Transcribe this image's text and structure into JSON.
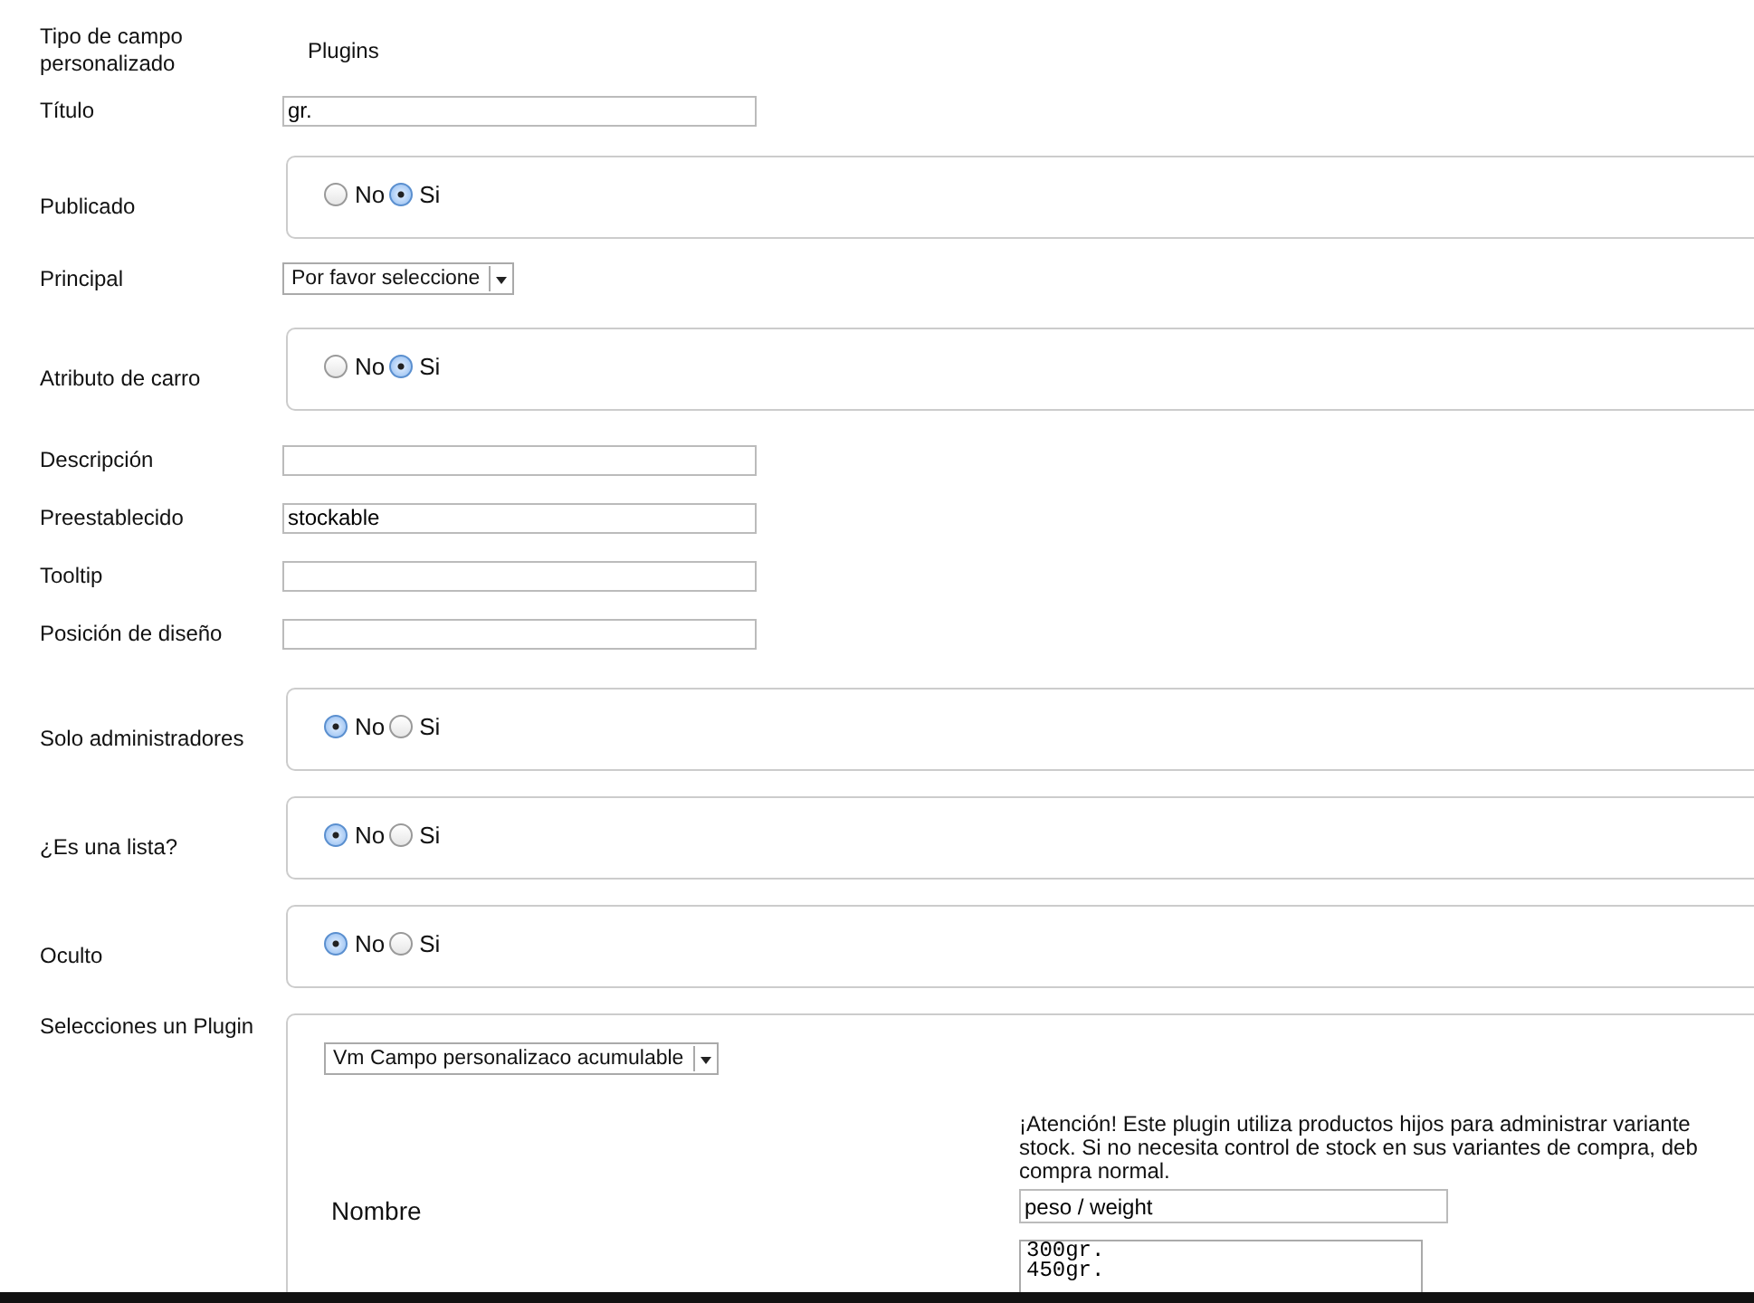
{
  "fields": [
    {
      "kind": "text",
      "label": "Tipo de campo personalizado",
      "value": "Plugins"
    },
    {
      "kind": "input",
      "label": "Título",
      "value": "gr."
    },
    {
      "kind": "radio",
      "label": "Publicado",
      "options": [
        {
          "label": "No",
          "selected": false
        },
        {
          "label": "Si",
          "selected": true
        }
      ]
    },
    {
      "kind": "select",
      "label": "Principal",
      "value": "Por favor seleccione"
    },
    {
      "kind": "radio",
      "label": "Atributo de carro",
      "options": [
        {
          "label": "No",
          "selected": false
        },
        {
          "label": "Si",
          "selected": true
        }
      ]
    },
    {
      "kind": "input",
      "label": "Descripción"
    },
    {
      "kind": "input",
      "label": "Preestablecido",
      "value": "stockable"
    },
    {
      "kind": "input",
      "label": "Tooltip"
    },
    {
      "kind": "input",
      "label": "Posición de diseño"
    },
    {
      "kind": "radio",
      "label": "Solo administradores",
      "options": [
        {
          "label": "No",
          "selected": true
        },
        {
          "label": "Si",
          "selected": false
        }
      ]
    },
    {
      "kind": "radio",
      "label": "¿Es una lista?",
      "options": [
        {
          "label": "No",
          "selected": true
        },
        {
          "label": "Si",
          "selected": false
        }
      ]
    },
    {
      "kind": "radio",
      "label": "Oculto",
      "options": [
        {
          "label": "No",
          "selected": true
        },
        {
          "label": "Si",
          "selected": false
        }
      ]
    },
    {
      "kind": "plugin",
      "label": "Selecciones un Plugin",
      "plugin": {
        "select": "Vm Campo personalizaco acumulable",
        "notice_lines": [
          "¡Atención! Este plugin utiliza productos hijos para administrar variante",
          "stock. Si no necesita control de stock en sus variantes de compra, deb",
          "compra normal."
        ],
        "name_label": "Nombre",
        "name_value": "peso / weight",
        "values": "300gr.\n450gr."
      }
    }
  ]
}
